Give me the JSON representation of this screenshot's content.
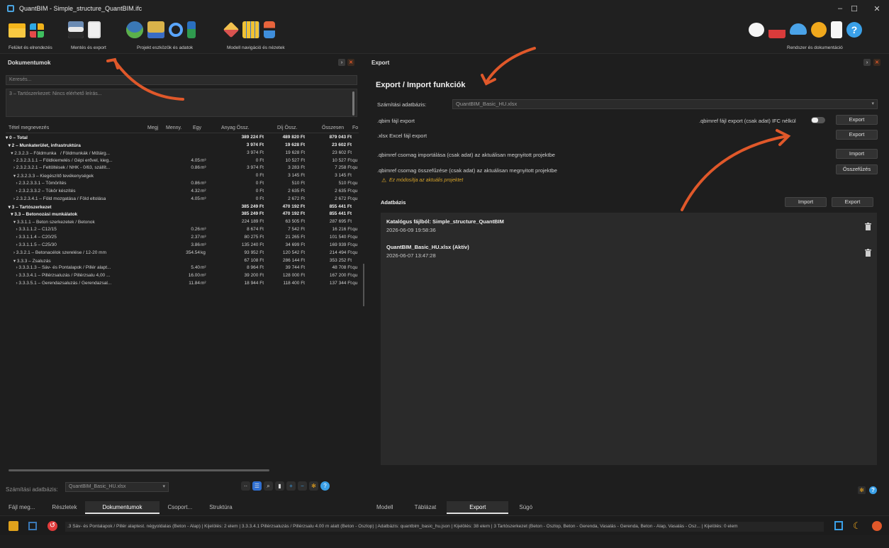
{
  "app": {
    "title": "QuantBIM - Simple_structure_QuantBIM.ifc"
  },
  "ribbon": {
    "groups": [
      {
        "label": "Felület és elrendezés"
      },
      {
        "label": "Mentés és export"
      },
      {
        "label": "Projekt eszközök és adatok"
      },
      {
        "label": "Modell navigáció és nézetek"
      },
      {
        "label": "Rendszer és dokumentáció"
      }
    ]
  },
  "left": {
    "title": "Dokumentumok",
    "search_placeholder": "Keresés...",
    "description": "3 – Tartószerkezet: Nincs elérhető leírás...",
    "columns": [
      "Tétel megnevezés",
      "Megj",
      "Menny.",
      "Egy",
      "Anyag Össz.",
      "Díj Össz.",
      "Összesen",
      "Fo"
    ],
    "rows": [
      {
        "name": "▾ 0 – Total",
        "menny": "",
        "egy": "",
        "anyag": "389 224 Ft",
        "dij": "489 820 Ft",
        "ossz": "879 043 Ft",
        "fo": "",
        "bold": true
      },
      {
        "name": "  ▾ 2 – Munkaterület, infrastruktúra",
        "menny": "",
        "egy": "",
        "anyag": "3 974 Ft",
        "dij": "19 628 Ft",
        "ossz": "23 602 Ft",
        "fo": "",
        "bold": true
      },
      {
        "name": "    ▾ 2.3.2.3 – Földmunka   / Földmunkák / Műtárg...",
        "menny": "",
        "egy": "",
        "anyag": "3 974 Ft",
        "dij": "19 628 Ft",
        "ossz": "23 602 Ft",
        "fo": ""
      },
      {
        "name": "      › 2.3.2.3.1.1 – Földkiemelés / Gépi erővel, kieg...",
        "menny": "4.05",
        "egy": "m³",
        "anyag": "0 Ft",
        "dij": "10 527 Ft",
        "ossz": "10 527 Ft",
        "fo": "qu"
      },
      {
        "name": "      › 2.3.2.3.2.1 – Feltöltések / NHK - 0/63, szállít...",
        "menny": "0.86",
        "egy": "m³",
        "anyag": "3 974 Ft",
        "dij": "3 283 Ft",
        "ossz": "7 258 Ft",
        "fo": "qu"
      },
      {
        "name": "      ▾ 2.3.2.3.3 – Kiegészítő tevékenységek",
        "menny": "",
        "egy": "",
        "anyag": "0 Ft",
        "dij": "3 145 Ft",
        "ossz": "3 145 Ft",
        "fo": ""
      },
      {
        "name": "        › 2.3.2.3.3.1 – Tömörítés",
        "menny": "0.86",
        "egy": "m³",
        "anyag": "0 Ft",
        "dij": "510 Ft",
        "ossz": "510 Ft",
        "fo": "qu"
      },
      {
        "name": "        › 2.3.2.3.3.2 – Tükör készítés",
        "menny": "4.32",
        "egy": "m²",
        "anyag": "0 Ft",
        "dij": "2 635 Ft",
        "ossz": "2 635 Ft",
        "fo": "qu"
      },
      {
        "name": "      › 2.3.2.3.4.1 – Föld mozgatása / Föld eltolása",
        "menny": "4.05",
        "egy": "m³",
        "anyag": "0 Ft",
        "dij": "2 672 Ft",
        "ossz": "2 672 Ft",
        "fo": "qu"
      },
      {
        "name": "  ▾ 3 – Tartószerkezet",
        "menny": "",
        "egy": "",
        "anyag": "385 249 Ft",
        "dij": "470 192 Ft",
        "ossz": "855 441 Ft",
        "fo": "",
        "bold": true
      },
      {
        "name": "    ▾ 3.3 – Betonozási munkálatok",
        "menny": "",
        "egy": "",
        "anyag": "385 249 Ft",
        "dij": "470 192 Ft",
        "ossz": "855 441 Ft",
        "fo": "",
        "bold": true
      },
      {
        "name": "      ▾ 3.3.1.1 – Beton szerkezetek / Betonok",
        "menny": "",
        "egy": "",
        "anyag": "224 189 Ft",
        "dij": "63 505 Ft",
        "ossz": "287 695 Ft",
        "fo": ""
      },
      {
        "name": "        › 3.3.1.1.2 – C12/15",
        "menny": "0.26",
        "egy": "m³",
        "anyag": "8 674 Ft",
        "dij": "7 542 Ft",
        "ossz": "16 216 Ft",
        "fo": "qu"
      },
      {
        "name": "        › 3.3.1.1.4 – C20/25",
        "menny": "2.37",
        "egy": "m³",
        "anyag": "80 275 Ft",
        "dij": "21 265 Ft",
        "ossz": "101 540 Ft",
        "fo": "qu"
      },
      {
        "name": "        › 3.3.1.1.5 – C25/30",
        "menny": "3.86",
        "egy": "m³",
        "anyag": "135 240 Ft",
        "dij": "34 699 Ft",
        "ossz": "169 939 Ft",
        "fo": "qu"
      },
      {
        "name": "      › 3.3.2.1 – Betonacélok szerelése / 12-20 mm",
        "menny": "354.54",
        "egy": "kg",
        "anyag": "93 952 Ft",
        "dij": "120 542 Ft",
        "ossz": "214 494 Ft",
        "fo": "qu"
      },
      {
        "name": "      ▾ 3.3.3 – Zsaluzás",
        "menny": "",
        "egy": "",
        "anyag": "67 108 Ft",
        "dij": "286 144 Ft",
        "ossz": "353 252 Ft",
        "fo": ""
      },
      {
        "name": "        › 3.3.3.1.3 – Sáv- és Pontalapok / Pillér alapt...",
        "menny": "5.40",
        "egy": "m²",
        "anyag": "8 964 Ft",
        "dij": "39 744 Ft",
        "ossz": "48 708 Ft",
        "fo": "qu"
      },
      {
        "name": "        › 3.3.3.4.1 – Pillérzsaluzás / Pillérzsalu 4,00 ...",
        "menny": "16.00",
        "egy": "m²",
        "anyag": "39 200 Ft",
        "dij": "128 000 Ft",
        "ossz": "167 200 Ft",
        "fo": "qu"
      },
      {
        "name": "        › 3.3.3.5.1 – Gerendazsaluzás / Gerendazsal...",
        "menny": "11.84",
        "egy": "m²",
        "anyag": "18 944 Ft",
        "dij": "118 400 Ft",
        "ossz": "137 344 Ft",
        "fo": "qu"
      }
    ],
    "db_label": "Számítási adatbázis:",
    "db_value": "QuantBIM_Basic_HU.xlsx",
    "tabs": [
      "Fájl meg...",
      "Részletek",
      "Dokumentumok",
      "Csoport...",
      "Struktúra"
    ],
    "active_tab": "Dokumentumok"
  },
  "right": {
    "title": "Export",
    "heading": "Export / Import funkciók",
    "db_label": "Számítási adatbázis:",
    "db_value": "QuantBIM_Basic_HU.xlsx",
    "qbim_export": ".qbim fájl export",
    "qbimref_export": ".qbimref fájl export (csak adat) IFC nélkül",
    "xlsx_export": ".xlsx Excel fájl export",
    "qbimref_import": ".qbimref csomag importálása (csak adat) az aktuálisan megnyitott projektbe",
    "qbimref_merge": ".qbimref csomag összefűzése (csak adat) az aktuálisan megnyitott projektbe",
    "warning": "Ez módosítja az aktuális projektet",
    "export_btn": "Export",
    "import_btn": "Import",
    "merge_btn": "Összefűzés",
    "adatbazis_title": "Adatbázis",
    "db_items": [
      {
        "name": "Katalógus fájlból: Simple_structure_QuantBIM",
        "date": "2026-06-09 19:58:36"
      },
      {
        "name": "QuantBIM_Basic_HU.xlsx (Aktív)",
        "date": "2026-06-07 13:47:28"
      }
    ],
    "tabs": [
      "Modell",
      "Táblázat",
      "Export",
      "Súgó"
    ],
    "active_tab": "Export"
  },
  "status": {
    "text": ".3 Sáv- és Pontalapok / Pillér alaptest. négyoldalas (Beton - Alap) | Kijelölés: 2 elem | 3.3.3.4.1 Pillérzsaluzás / Pillérzsalu 4.00 m alatt (Beton - Oszlop) | Adatbázis: quantbim_basic_hu.json | Kijelölés: 38 elem | 3 Tartószerkezet (Beton - Oszlop, Beton - Gerenda, Vasalás - Gerenda, Beton - Alap, Vasalás - Osz... | Kijelölés: 0 elem"
  },
  "colors": {
    "accent": "#e0582a",
    "highlight": "#2f6fd1",
    "warn": "#d6a32b"
  }
}
